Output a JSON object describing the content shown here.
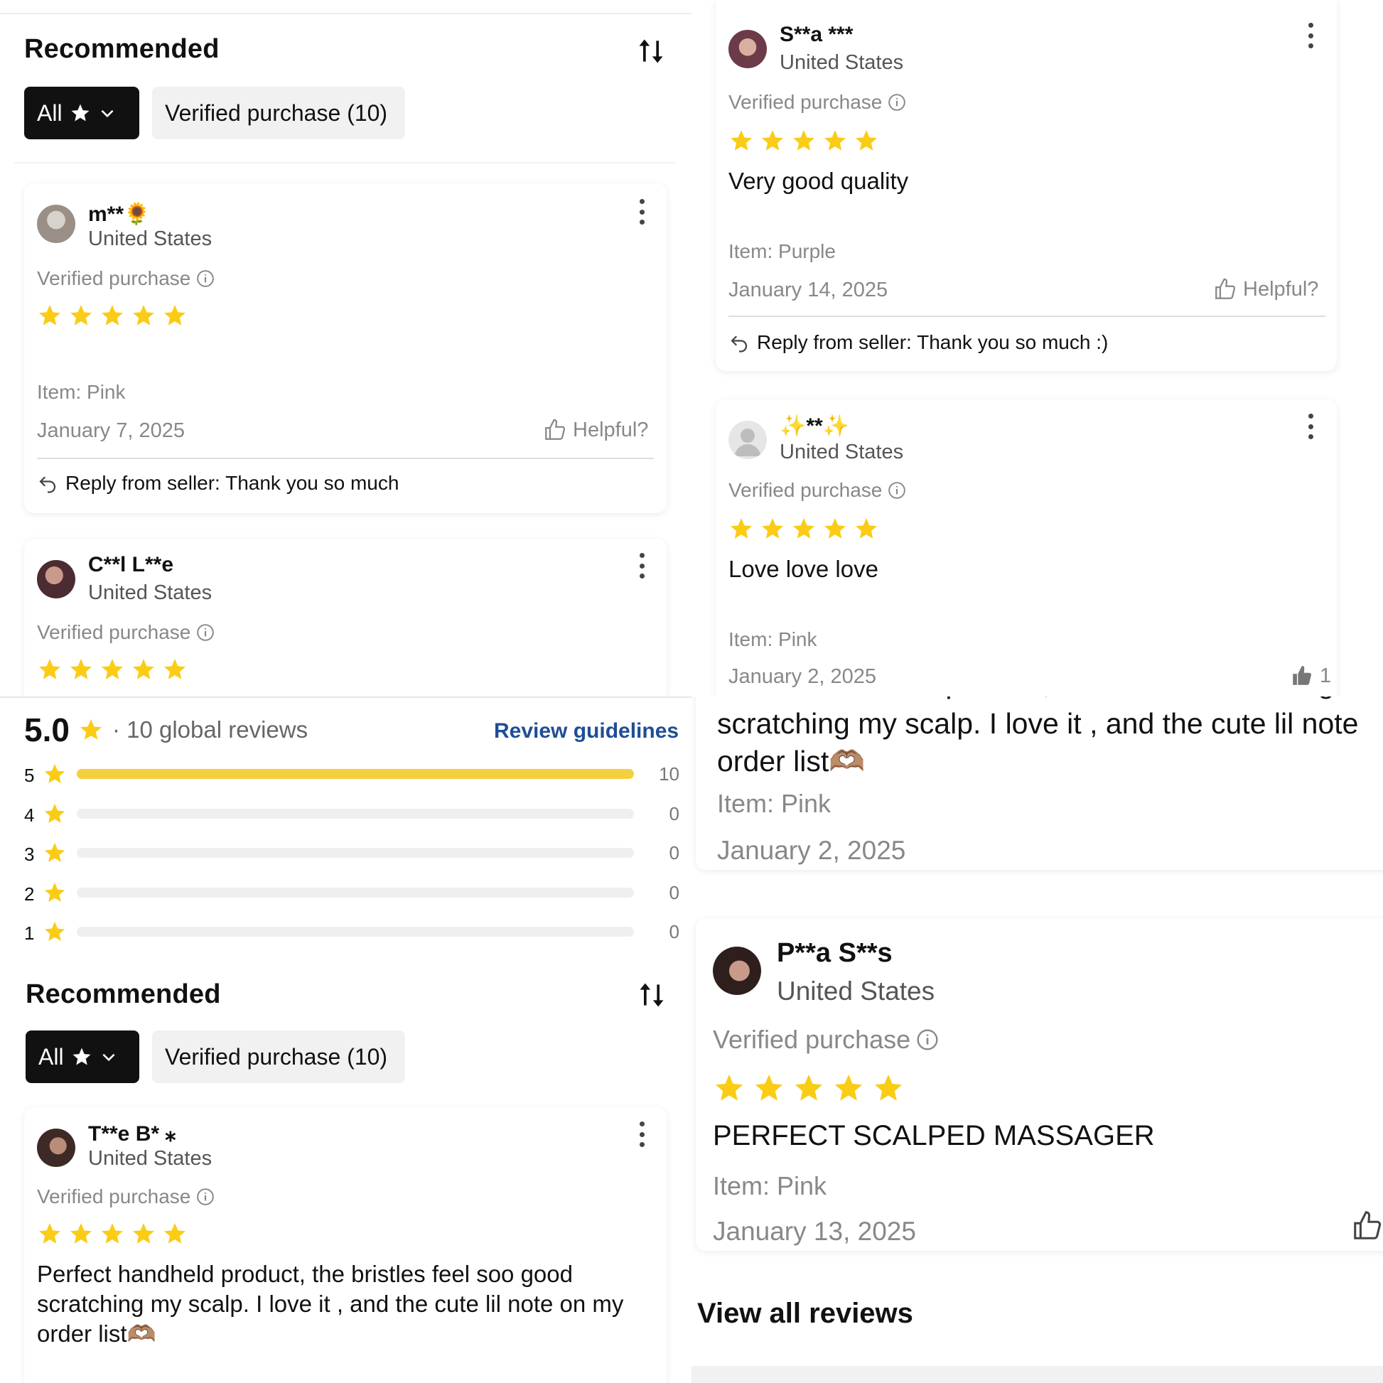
{
  "colors": {
    "star": "#FACC15",
    "bar_fill": "#F4D03F",
    "link": "#1f4e96",
    "filter_active_bg": "#111111"
  },
  "panel1": {
    "title": "Recommended",
    "filter_all": "All",
    "filter_verified": "Verified purchase (10)",
    "reviews": [
      {
        "name": "m**",
        "name_emoji": "🌻",
        "country": "United States",
        "verified": "Verified purchase",
        "rating": 5,
        "item": "Item: Pink",
        "date": "January 7, 2025",
        "helpful": "Helpful?",
        "reply": "Reply from seller: Thank you so much"
      },
      {
        "name": "C**l L**e",
        "country": "United States",
        "verified": "Verified purchase",
        "rating": 5
      }
    ]
  },
  "panel2": {
    "reviews": [
      {
        "name": "S**a ***",
        "country": "United States",
        "verified": "Verified purchase",
        "rating": 5,
        "text": "Very good quality",
        "item": "Item: Purple",
        "date": "January 14, 2025",
        "helpful": "Helpful?",
        "reply": "Reply from seller: Thank you so much :)"
      },
      {
        "name": "✨**✨",
        "country": "United States",
        "verified": "Verified purchase",
        "rating": 5,
        "text": "Love love love",
        "item": "Item: Pink",
        "date": "January 2, 2025",
        "helpful_count": "1"
      }
    ]
  },
  "panel3": {
    "score": "5.0",
    "global_reviews": "· 10 global reviews",
    "guidelines_link": "Review guidelines",
    "distribution": [
      {
        "stars": "5",
        "count": "10",
        "fraction": 1.0
      },
      {
        "stars": "4",
        "count": "0",
        "fraction": 0
      },
      {
        "stars": "3",
        "count": "0",
        "fraction": 0
      },
      {
        "stars": "2",
        "count": "0",
        "fraction": 0
      },
      {
        "stars": "1",
        "count": "0",
        "fraction": 0
      }
    ],
    "title": "Recommended",
    "filter_all": "All",
    "filter_verified": "Verified purchase (10)",
    "review": {
      "name": "T**e B* ⁎",
      "country": "United States",
      "verified": "Verified purchase",
      "rating": 5,
      "text": "Perfect handheld product, the bristles feel soo good scratching my scalp. I love it , and the cute lil note on my order list🫶🏽"
    }
  },
  "panel4": {
    "top_text": "scratching my scalp. I love it , and the cute lil note order list🫶🏽",
    "top_item": "Item: Pink",
    "top_date": "January 2, 2025",
    "review": {
      "name": "P**a S**s",
      "country": "United States",
      "verified": "Verified purchase",
      "rating": 5,
      "text": "PERFECT SCALPED MASSAGER",
      "item": "Item: Pink",
      "date": "January 13, 2025"
    },
    "view_all": "View all reviews"
  }
}
